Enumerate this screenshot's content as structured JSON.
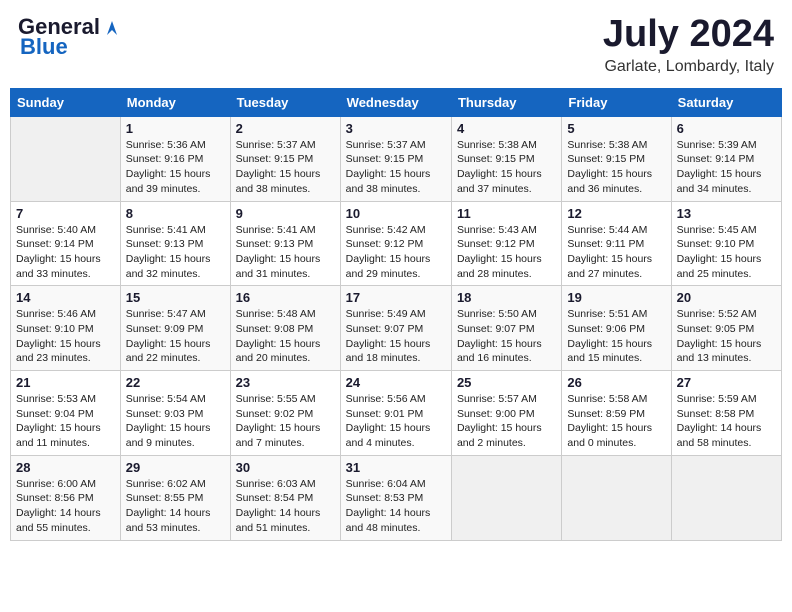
{
  "header": {
    "logo_general": "General",
    "logo_blue": "Blue",
    "month": "July 2024",
    "location": "Garlate, Lombardy, Italy"
  },
  "columns": [
    "Sunday",
    "Monday",
    "Tuesday",
    "Wednesday",
    "Thursday",
    "Friday",
    "Saturday"
  ],
  "weeks": [
    [
      {
        "day": "",
        "info": ""
      },
      {
        "day": "1",
        "info": "Sunrise: 5:36 AM\nSunset: 9:16 PM\nDaylight: 15 hours\nand 39 minutes."
      },
      {
        "day": "2",
        "info": "Sunrise: 5:37 AM\nSunset: 9:15 PM\nDaylight: 15 hours\nand 38 minutes."
      },
      {
        "day": "3",
        "info": "Sunrise: 5:37 AM\nSunset: 9:15 PM\nDaylight: 15 hours\nand 38 minutes."
      },
      {
        "day": "4",
        "info": "Sunrise: 5:38 AM\nSunset: 9:15 PM\nDaylight: 15 hours\nand 37 minutes."
      },
      {
        "day": "5",
        "info": "Sunrise: 5:38 AM\nSunset: 9:15 PM\nDaylight: 15 hours\nand 36 minutes."
      },
      {
        "day": "6",
        "info": "Sunrise: 5:39 AM\nSunset: 9:14 PM\nDaylight: 15 hours\nand 34 minutes."
      }
    ],
    [
      {
        "day": "7",
        "info": "Sunrise: 5:40 AM\nSunset: 9:14 PM\nDaylight: 15 hours\nand 33 minutes."
      },
      {
        "day": "8",
        "info": "Sunrise: 5:41 AM\nSunset: 9:13 PM\nDaylight: 15 hours\nand 32 minutes."
      },
      {
        "day": "9",
        "info": "Sunrise: 5:41 AM\nSunset: 9:13 PM\nDaylight: 15 hours\nand 31 minutes."
      },
      {
        "day": "10",
        "info": "Sunrise: 5:42 AM\nSunset: 9:12 PM\nDaylight: 15 hours\nand 29 minutes."
      },
      {
        "day": "11",
        "info": "Sunrise: 5:43 AM\nSunset: 9:12 PM\nDaylight: 15 hours\nand 28 minutes."
      },
      {
        "day": "12",
        "info": "Sunrise: 5:44 AM\nSunset: 9:11 PM\nDaylight: 15 hours\nand 27 minutes."
      },
      {
        "day": "13",
        "info": "Sunrise: 5:45 AM\nSunset: 9:10 PM\nDaylight: 15 hours\nand 25 minutes."
      }
    ],
    [
      {
        "day": "14",
        "info": "Sunrise: 5:46 AM\nSunset: 9:10 PM\nDaylight: 15 hours\nand 23 minutes."
      },
      {
        "day": "15",
        "info": "Sunrise: 5:47 AM\nSunset: 9:09 PM\nDaylight: 15 hours\nand 22 minutes."
      },
      {
        "day": "16",
        "info": "Sunrise: 5:48 AM\nSunset: 9:08 PM\nDaylight: 15 hours\nand 20 minutes."
      },
      {
        "day": "17",
        "info": "Sunrise: 5:49 AM\nSunset: 9:07 PM\nDaylight: 15 hours\nand 18 minutes."
      },
      {
        "day": "18",
        "info": "Sunrise: 5:50 AM\nSunset: 9:07 PM\nDaylight: 15 hours\nand 16 minutes."
      },
      {
        "day": "19",
        "info": "Sunrise: 5:51 AM\nSunset: 9:06 PM\nDaylight: 15 hours\nand 15 minutes."
      },
      {
        "day": "20",
        "info": "Sunrise: 5:52 AM\nSunset: 9:05 PM\nDaylight: 15 hours\nand 13 minutes."
      }
    ],
    [
      {
        "day": "21",
        "info": "Sunrise: 5:53 AM\nSunset: 9:04 PM\nDaylight: 15 hours\nand 11 minutes."
      },
      {
        "day": "22",
        "info": "Sunrise: 5:54 AM\nSunset: 9:03 PM\nDaylight: 15 hours\nand 9 minutes."
      },
      {
        "day": "23",
        "info": "Sunrise: 5:55 AM\nSunset: 9:02 PM\nDaylight: 15 hours\nand 7 minutes."
      },
      {
        "day": "24",
        "info": "Sunrise: 5:56 AM\nSunset: 9:01 PM\nDaylight: 15 hours\nand 4 minutes."
      },
      {
        "day": "25",
        "info": "Sunrise: 5:57 AM\nSunset: 9:00 PM\nDaylight: 15 hours\nand 2 minutes."
      },
      {
        "day": "26",
        "info": "Sunrise: 5:58 AM\nSunset: 8:59 PM\nDaylight: 15 hours\nand 0 minutes."
      },
      {
        "day": "27",
        "info": "Sunrise: 5:59 AM\nSunset: 8:58 PM\nDaylight: 14 hours\nand 58 minutes."
      }
    ],
    [
      {
        "day": "28",
        "info": "Sunrise: 6:00 AM\nSunset: 8:56 PM\nDaylight: 14 hours\nand 55 minutes."
      },
      {
        "day": "29",
        "info": "Sunrise: 6:02 AM\nSunset: 8:55 PM\nDaylight: 14 hours\nand 53 minutes."
      },
      {
        "day": "30",
        "info": "Sunrise: 6:03 AM\nSunset: 8:54 PM\nDaylight: 14 hours\nand 51 minutes."
      },
      {
        "day": "31",
        "info": "Sunrise: 6:04 AM\nSunset: 8:53 PM\nDaylight: 14 hours\nand 48 minutes."
      },
      {
        "day": "",
        "info": ""
      },
      {
        "day": "",
        "info": ""
      },
      {
        "day": "",
        "info": ""
      }
    ]
  ]
}
